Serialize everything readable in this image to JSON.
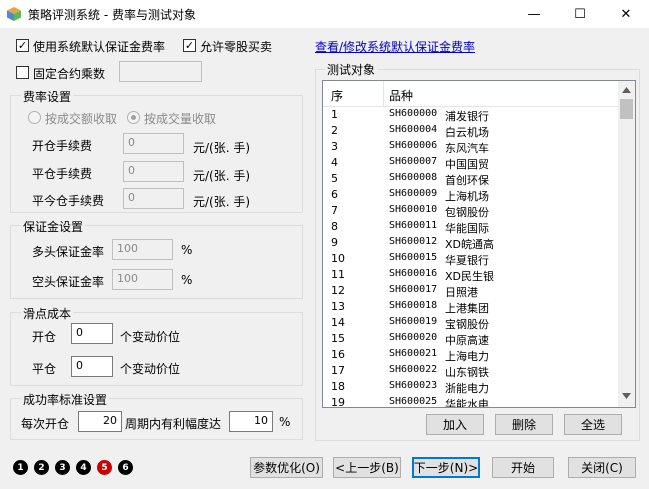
{
  "window": {
    "title": "策略评测系统 - 费率与测试对象",
    "minimize": "—",
    "maximize": "☐",
    "close": "✕"
  },
  "options": {
    "use_default_margin": "使用系统默认保证金费率",
    "use_default_margin_checked": true,
    "allow_odd_lot": "允许零股买卖",
    "allow_odd_lot_checked": true,
    "view_modify_link": "查看/修改系统默认保证金费率",
    "fixed_multiplier": "固定合约乘数",
    "fixed_multiplier_checked": false,
    "fixed_multiplier_value": ""
  },
  "fee_settings": {
    "title": "费率设置",
    "by_amount": "按成交额收取",
    "by_volume": "按成交量收取",
    "open_fee_label": "开仓手续费",
    "open_fee_value": "0",
    "close_fee_label": "平仓手续费",
    "close_fee_value": "0",
    "close_today_fee_label": "平今仓手续费",
    "close_today_fee_value": "0",
    "unit": "元/(张. 手)"
  },
  "margin_settings": {
    "title": "保证金设置",
    "long_label": "多头保证金率",
    "long_value": "100",
    "short_label": "空头保证金率",
    "short_value": "100",
    "unit": "%"
  },
  "slippage": {
    "title": "滑点成本",
    "open_label": "开仓",
    "open_value": "0",
    "close_label": "平仓",
    "close_value": "0",
    "unit": "个变动价位"
  },
  "success_rate": {
    "title": "成功率标准设置",
    "prefix": "每次开仓",
    "period_value": "20",
    "middle": "周期内有利幅度达",
    "percent_value": "10",
    "unit": "%"
  },
  "test_objects": {
    "title": "测试对象",
    "col_index": "序",
    "col_symbol": "品种",
    "rows": [
      {
        "idx": "1",
        "code": "SH600000",
        "name": "浦发银行"
      },
      {
        "idx": "2",
        "code": "SH600004",
        "name": "白云机场"
      },
      {
        "idx": "3",
        "code": "SH600006",
        "name": "东风汽车"
      },
      {
        "idx": "4",
        "code": "SH600007",
        "name": "中国国贸"
      },
      {
        "idx": "5",
        "code": "SH600008",
        "name": "首创环保"
      },
      {
        "idx": "6",
        "code": "SH600009",
        "name": "上海机场"
      },
      {
        "idx": "7",
        "code": "SH600010",
        "name": "包钢股份"
      },
      {
        "idx": "8",
        "code": "SH600011",
        "name": "华能国际"
      },
      {
        "idx": "9",
        "code": "SH600012",
        "name": "XD皖通高"
      },
      {
        "idx": "10",
        "code": "SH600015",
        "name": "华夏银行"
      },
      {
        "idx": "11",
        "code": "SH600016",
        "name": "XD民生银"
      },
      {
        "idx": "12",
        "code": "SH600017",
        "name": "日照港"
      },
      {
        "idx": "13",
        "code": "SH600018",
        "name": "上港集团"
      },
      {
        "idx": "14",
        "code": "SH600019",
        "name": "宝钢股份"
      },
      {
        "idx": "15",
        "code": "SH600020",
        "name": "中原高速"
      },
      {
        "idx": "16",
        "code": "SH600021",
        "name": "上海电力"
      },
      {
        "idx": "17",
        "code": "SH600022",
        "name": "山东钢铁"
      },
      {
        "idx": "18",
        "code": "SH600023",
        "name": "浙能电力"
      },
      {
        "idx": "19",
        "code": "SH600025",
        "name": "华能水电"
      }
    ],
    "add_button": "加入",
    "delete_button": "删除",
    "select_all_button": "全选"
  },
  "steps": [
    "1",
    "2",
    "3",
    "4",
    "5",
    "6"
  ],
  "footer": {
    "optimize_button": "参数优化(O)",
    "prev_button": "<上一步(B)",
    "next_button": "下一步(N)>",
    "start_button": "开始",
    "close_button": "关闭(C)"
  }
}
